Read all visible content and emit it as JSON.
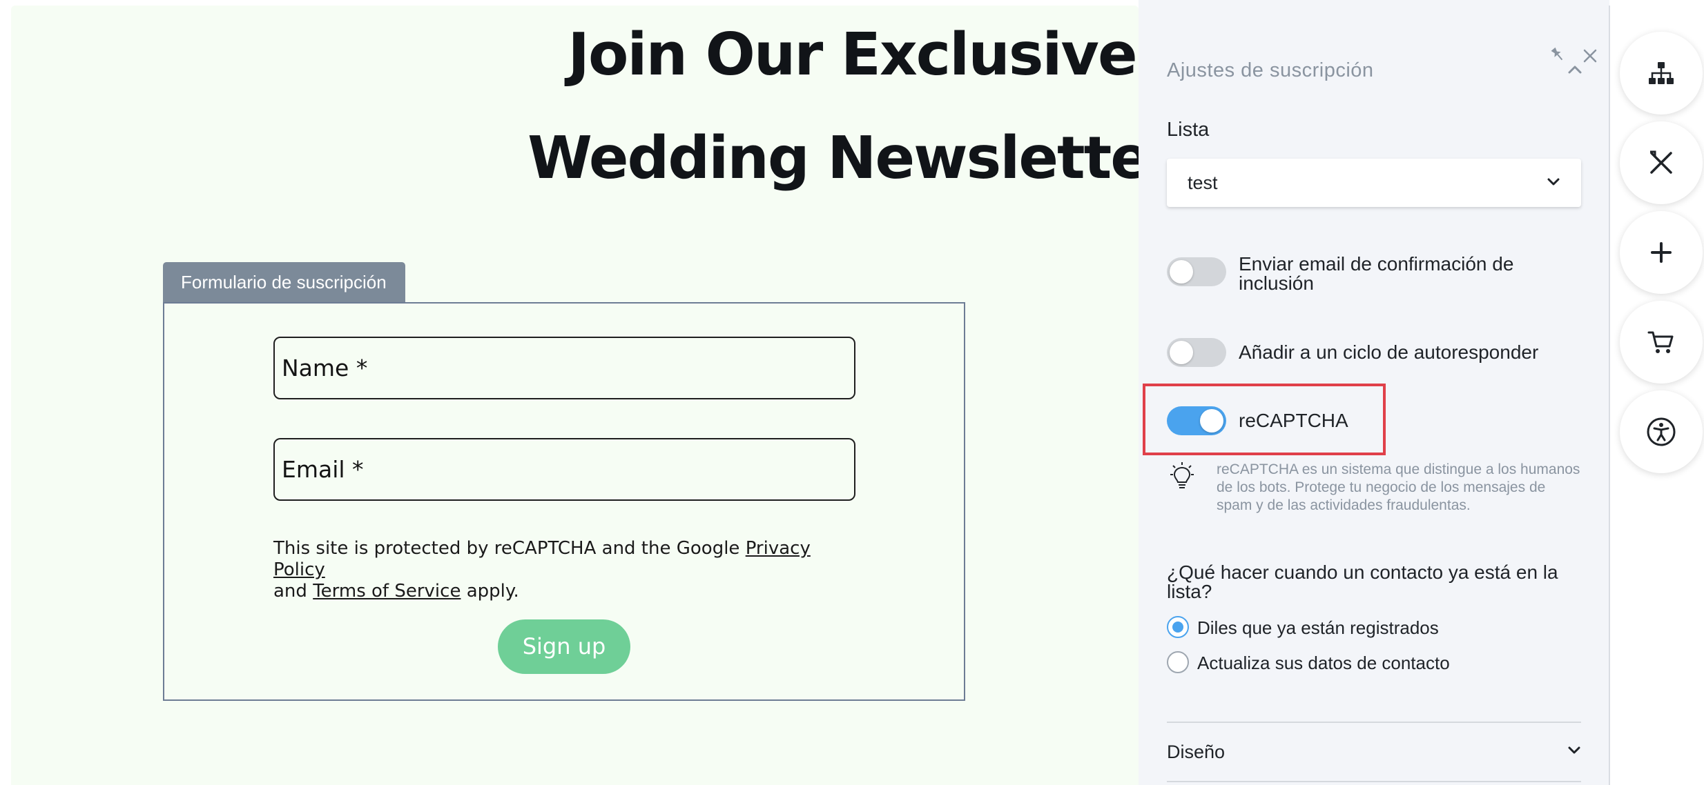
{
  "canvas": {
    "headline_line1": "Join Our Exclusive",
    "headline_line2": "Wedding Newsletter",
    "form_tab": "Formulario de suscripción",
    "name_placeholder": "Name *",
    "email_placeholder": "Email *",
    "legal": {
      "pre": "This site is protected by reCAPTCHA and the Google ",
      "privacy_link": "Privacy Policy",
      "and": " and ",
      "terms_link": "Terms of Service",
      "post": " apply."
    },
    "signup_label": "Sign up",
    "colors": {
      "background": "#f6fdf4",
      "button": "#6fcf97",
      "tab": "#7c8a99"
    }
  },
  "panel": {
    "title": "Ajustes de suscripción",
    "list_label": "Lista",
    "list_value": "test",
    "toggles": [
      {
        "label": "Enviar email de confirmación de inclusión",
        "on": false
      },
      {
        "label": "Añadir a un ciclo de autoresponder",
        "on": false
      },
      {
        "label": "reCAPTCHA",
        "on": true
      }
    ],
    "recaptcha_hint": "reCAPTCHA es un sistema que distingue a los humanos de los bots. Protege tu negocio de los mensajes de spam y de las actividades fraudulentas.",
    "question": "¿Qué hacer cuando un contacto ya está en la lista?",
    "radio_options": [
      {
        "label": "Diles que ya están registrados",
        "checked": true
      },
      {
        "label": "Actualiza sus datos de contacto",
        "checked": false
      }
    ],
    "design_section": "Diseño",
    "colors": {
      "accent": "#4aa3ee",
      "highlight": "#e0404a"
    }
  },
  "rail": {
    "buttons": [
      "sitemap-icon",
      "tools-icon",
      "plus-icon",
      "cart-icon",
      "accessibility-icon"
    ]
  }
}
